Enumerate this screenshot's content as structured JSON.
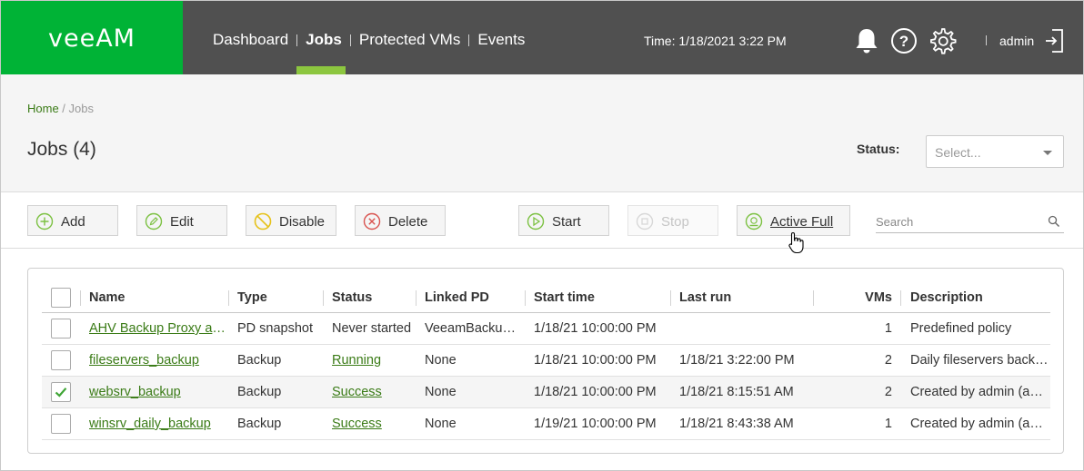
{
  "brand": {
    "logo": "veeam",
    "accent": "#00b336",
    "nav_accent": "#8cc63f",
    "header_bg": "#505050"
  },
  "nav": {
    "items": [
      "Dashboard",
      "Jobs",
      "Protected VMs",
      "Events"
    ],
    "active": "Jobs"
  },
  "header": {
    "time": "Time: 1/18/2021 3:22 PM",
    "user": "admin",
    "icons": [
      "bell-icon",
      "help-icon",
      "gear-icon",
      "logout-icon"
    ]
  },
  "breadcrumb": {
    "home": "Home",
    "sep": " / ",
    "current": "Jobs"
  },
  "page": {
    "title": "Jobs (4)"
  },
  "status_filter": {
    "label": "Status:",
    "placeholder": "Select..."
  },
  "toolbar": {
    "add": "Add",
    "edit": "Edit",
    "disable": "Disable",
    "delete": "Delete",
    "start": "Start",
    "stop": "Stop",
    "active_full": "Active Full",
    "search_placeholder": "Search"
  },
  "table": {
    "columns": [
      "Name",
      "Type",
      "Status",
      "Linked PD",
      "Start time",
      "Last run",
      "VMs",
      "Description"
    ],
    "rows": [
      {
        "name": "AHV Backup Proxy ahv-proxy",
        "type": "PD snapshot",
        "status": "Never started",
        "linked_pd": "VeeamBackupPD",
        "start_time": "1/18/21 10:00:00 PM",
        "last_run": "",
        "vms": "1",
        "description": "Predefined policy",
        "selected": false
      },
      {
        "name": "fileservers_backup",
        "type": "Backup",
        "status": "Running",
        "linked_pd": "None",
        "start_time": "1/18/21 10:00:00 PM",
        "last_run": "1/18/21 3:22:00 PM",
        "vms": "2",
        "description": "Daily fileservers backup",
        "selected": false
      },
      {
        "name": "websrv_backup",
        "type": "Backup",
        "status": "Success",
        "linked_pd": "None",
        "start_time": "1/18/21 10:00:00 PM",
        "last_run": "1/18/21 8:15:51 AM",
        "vms": "2",
        "description": "Created by admin (ahv-proxy)",
        "selected": true
      },
      {
        "name": "winsrv_daily_backup",
        "type": "Backup",
        "status": "Success",
        "linked_pd": "None",
        "start_time": "1/19/21 10:00:00 PM",
        "last_run": "1/18/21 8:43:38 AM",
        "vms": "1",
        "description": "Created by admin (ahv-proxy)",
        "selected": false
      }
    ]
  }
}
